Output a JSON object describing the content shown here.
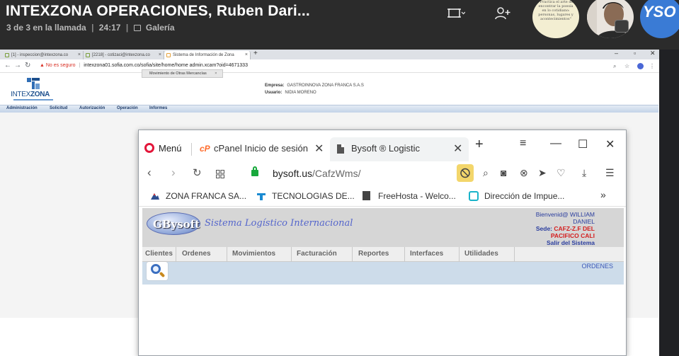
{
  "call": {
    "title": "INTEXZONA OPERACIONES, Ruben Dari...",
    "participants": "3 de 3 en la llamada",
    "duration": "24:17",
    "gallery_label": "Galería",
    "separator": "|",
    "avatar1_text": "\"Practica el arte de encontrar la poesía en lo cotidiano: personas, lugares y acontecimientos\"",
    "avatar3_initials": "YSO"
  },
  "chrome": {
    "tabs": [
      {
        "label": "[1] - inspeccion@intexzona.co"
      },
      {
        "label": "[2218] - cotizaci@intexzona.co"
      },
      {
        "label": "Sistema de Información de Zona"
      }
    ],
    "url_warning": "No es seguro",
    "url": "intexzona01.sofia.com.co/sofia/site/home/home admin.xcam?oid=4671333",
    "app": {
      "logo_text_a": "INTEX",
      "logo_text_b": "ZONA",
      "company_key": "Empresa:",
      "company_value": "GASTROINNOVA ZONA FRANCA S.A.S",
      "user_key": "Usuario:",
      "user_value": "NIDIA MORENO",
      "menu": [
        "Administración",
        "Solicitud",
        "Autorización",
        "Operación",
        "Informes"
      ],
      "subtab": "Movimiento de Otras Mercancías",
      "subtab_close": "×"
    }
  },
  "opera": {
    "menu_label": "Menú",
    "tabs": [
      {
        "label": "cPanel Inicio de sesión",
        "icon": "cP"
      },
      {
        "label": "Bysoft ® Logistic"
      }
    ],
    "url_host": "bysoft.us",
    "url_path": "/CafzWms/",
    "bookmarks": [
      {
        "label": "ZONA FRANCA SA..."
      },
      {
        "label": "TECNOLOGIAS DE..."
      },
      {
        "label": "FreeHosta - Welco..."
      },
      {
        "label": "Dirección de Impue..."
      }
    ],
    "bookmarks_more": "»"
  },
  "bysoft": {
    "logo": "GBysoft",
    "title": "Sistema  Logístico Internacional",
    "welcome": "Bienvenid@ WILLIAM",
    "welcome2": "DANIEL",
    "sede_label": "Sede:",
    "sede_value": "CAFZ-Z.F DEL",
    "sede_value2": "PACIFICO CALI",
    "logout": "Salir del Sistema",
    "menu": [
      "Clientes",
      "Ordenes",
      "Movimientos",
      "Facturación",
      "Reportes",
      "Interfaces",
      "Utilidades"
    ],
    "section_label": "ORDENES"
  }
}
